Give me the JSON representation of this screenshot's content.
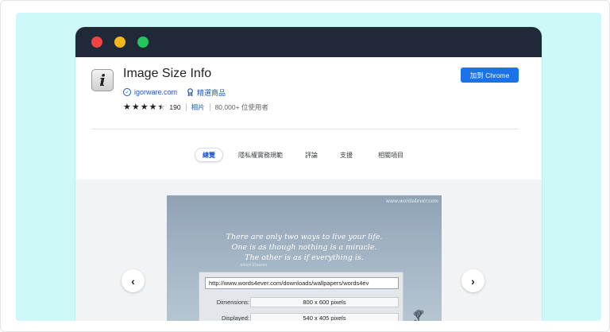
{
  "window": {
    "controls": [
      "close",
      "minimize",
      "maximize"
    ]
  },
  "extension": {
    "icon": "info-i-icon",
    "icon_glyph": "i",
    "title": "Image Size Info",
    "publisher": "igorware.com",
    "featured_label": "精選商品",
    "rating_value": 4.5,
    "rating_count": "190",
    "category": "相片",
    "users": "80,000+ 位使用者",
    "add_button": "加到 Chrome"
  },
  "tabs": [
    {
      "label": "總覽",
      "active": true
    },
    {
      "label": "隱私權實務規範",
      "active": false
    },
    {
      "label": "評論",
      "active": false
    },
    {
      "label": "支援",
      "active": false
    },
    {
      "label": "相關項目",
      "active": false
    }
  ],
  "screenshot": {
    "watermark": "www.words4ever.com",
    "quote_lines": [
      "There are only two ways to live your life.",
      "One is as though nothing is a miracle.",
      "The other is as if everything is."
    ],
    "author": "Albert Einstein",
    "url": "http://www.words4ever.com/downloads/wallpapers/words4ev",
    "dimensions_label": "Dimensions:",
    "dimensions_value": "800 x 600 pixels",
    "displayed_label": "Displayed:",
    "displayed_value": "540 x 405 pixels"
  },
  "gallery": {
    "prev_icon": "chevron-left-icon",
    "next_icon": "chevron-right-icon",
    "prev_glyph": "‹",
    "next_glyph": "›"
  },
  "colors": {
    "accent": "#1a73e8",
    "panel_bg": "#cdf8f8",
    "titlebar": "#1f2937"
  }
}
